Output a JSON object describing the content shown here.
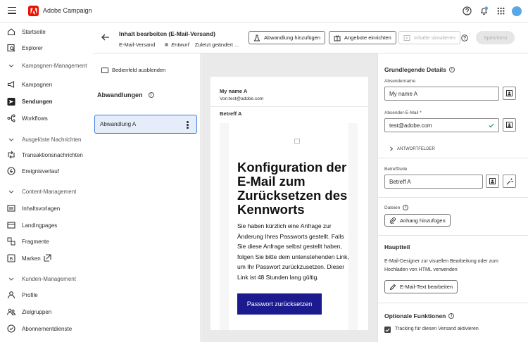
{
  "app": {
    "name": "Adobe Campaign"
  },
  "sidebar": {
    "items": [
      {
        "label": "Startseite"
      },
      {
        "label": "Explorer"
      },
      {
        "label": "Kampagnen-Management",
        "section": true
      },
      {
        "label": "Kampagnen"
      },
      {
        "label": "Sendungen",
        "active": true
      },
      {
        "label": "Workflows"
      },
      {
        "label": "Ausgelöste Nachrichten",
        "section": true
      },
      {
        "label": "Transaktionsnachrichten"
      },
      {
        "label": "Ereignisverlauf"
      },
      {
        "label": "Content-Management",
        "section": true
      },
      {
        "label": "Inhaltsvorlagen"
      },
      {
        "label": "Landingpages"
      },
      {
        "label": "Fragmente"
      },
      {
        "label": "Marken"
      },
      {
        "label": "Kunden-Management",
        "section": true
      },
      {
        "label": "Profile"
      },
      {
        "label": "Zielgruppen"
      },
      {
        "label": "Abonnementdienste"
      }
    ]
  },
  "header": {
    "title": "Inhalt bearbeiten (E-Mail-Versand)",
    "type": "E-Mail-Versand",
    "status": "Entwurf",
    "modified": "Zuletzt geändert ...",
    "buttons": {
      "add_variant": "Abwandlung hinzufügen",
      "offers": "Angebote einrichten",
      "simulate": "Inhalte simulieren",
      "save": "Speichern"
    }
  },
  "left_panel": {
    "hide": "Bedienfeld ausblenden",
    "variants_title": "Abwandlungen",
    "variants": [
      "Abwandlung A"
    ]
  },
  "preview": {
    "sender_name": "My name A",
    "sender_address": "Von:test@adobe.com",
    "subject": "Betreff A",
    "email_title": "Konfiguration der E-Mail zum Zurücksetzen des Kennworts",
    "email_body": "Sie haben kürzlich eine Anfrage zur Änderung Ihres Passworts gestellt. Falls Sie diese Anfrage selbst gestellt haben, folgen Sie bitte dem untenstehenden Link, um Ihr Passwort zurückzusetzen. Dieser Link ist 48 Stunden lang gültig.",
    "email_button": "Passwort zurücksetzen"
  },
  "right_panel": {
    "basics_title": "Grundlegende Details",
    "sender_name_label": "Absendername",
    "sender_name_value": "My name A",
    "sender_email_label": "Absender-E-Mail",
    "required_mark": "*",
    "sender_email_value": "test@adobe.com",
    "reply_fields": "ANTWORTFELDER",
    "subject_label": "Betreffzeile",
    "subject_value": "Betreff A",
    "files_label": "Dateien",
    "attach_button": "Anhang hinzufügen",
    "body_title": "Hauptteil",
    "body_desc": "E-Mail-Designer zur visuellen Bearbeitung oder zum Hochladen von HTML verwenden",
    "edit_body_button": "E-Mail-Text bearbeiten",
    "optional_title": "Optionale Funktionen",
    "tracking_label": "Tracking für diesen Versand aktivieren",
    "tracking_checked": true
  },
  "colors": {
    "brand": "#eb1000",
    "accent": "#3d7cdb",
    "email_button": "#1b1a8f",
    "valid": "#2d9d78"
  }
}
